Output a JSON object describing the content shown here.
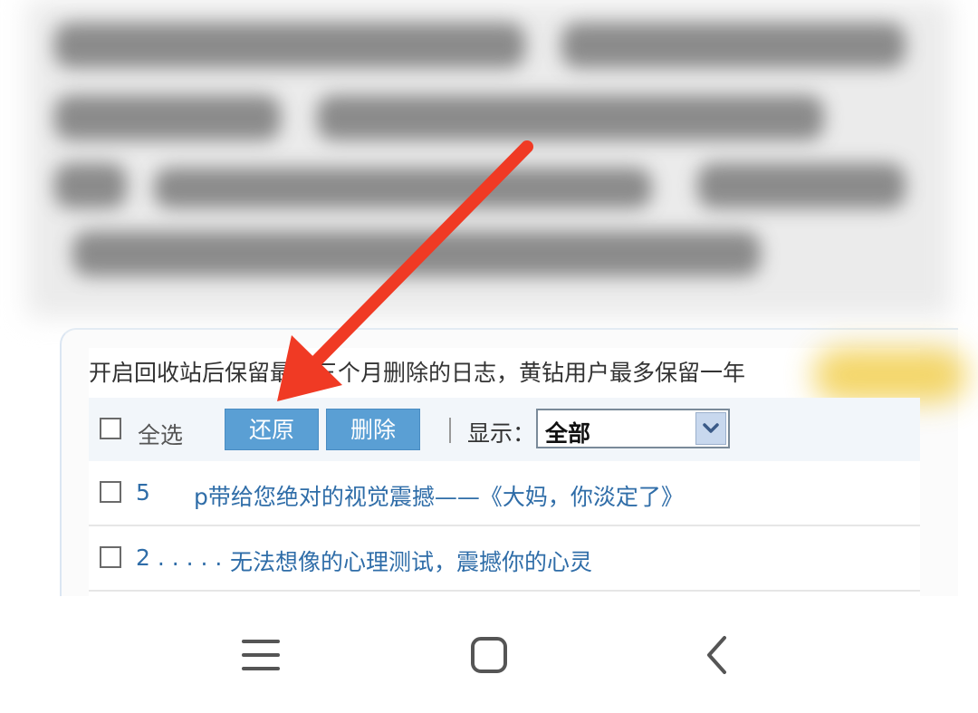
{
  "notice": "开启回收站后保留最近三个月删除的日志，黄钻用户最多保留一年",
  "toolbar": {
    "select_all_label": "全选",
    "restore_label": "还原",
    "delete_label": "删除",
    "display_label": "显示：",
    "display_value": "全部"
  },
  "rows": [
    {
      "prefix": "5",
      "title": "p带给您绝对的视觉震撼——《大妈，你淡定了》"
    },
    {
      "prefix": "2 . . . . .",
      "title": "无法想像的心理测试，震撼你的心灵"
    }
  ],
  "annotation": {
    "arrow_color": "#f03a24"
  },
  "nav": {
    "menu_icon": "menu-icon",
    "home_icon": "home-icon",
    "back_icon": "back-icon"
  }
}
